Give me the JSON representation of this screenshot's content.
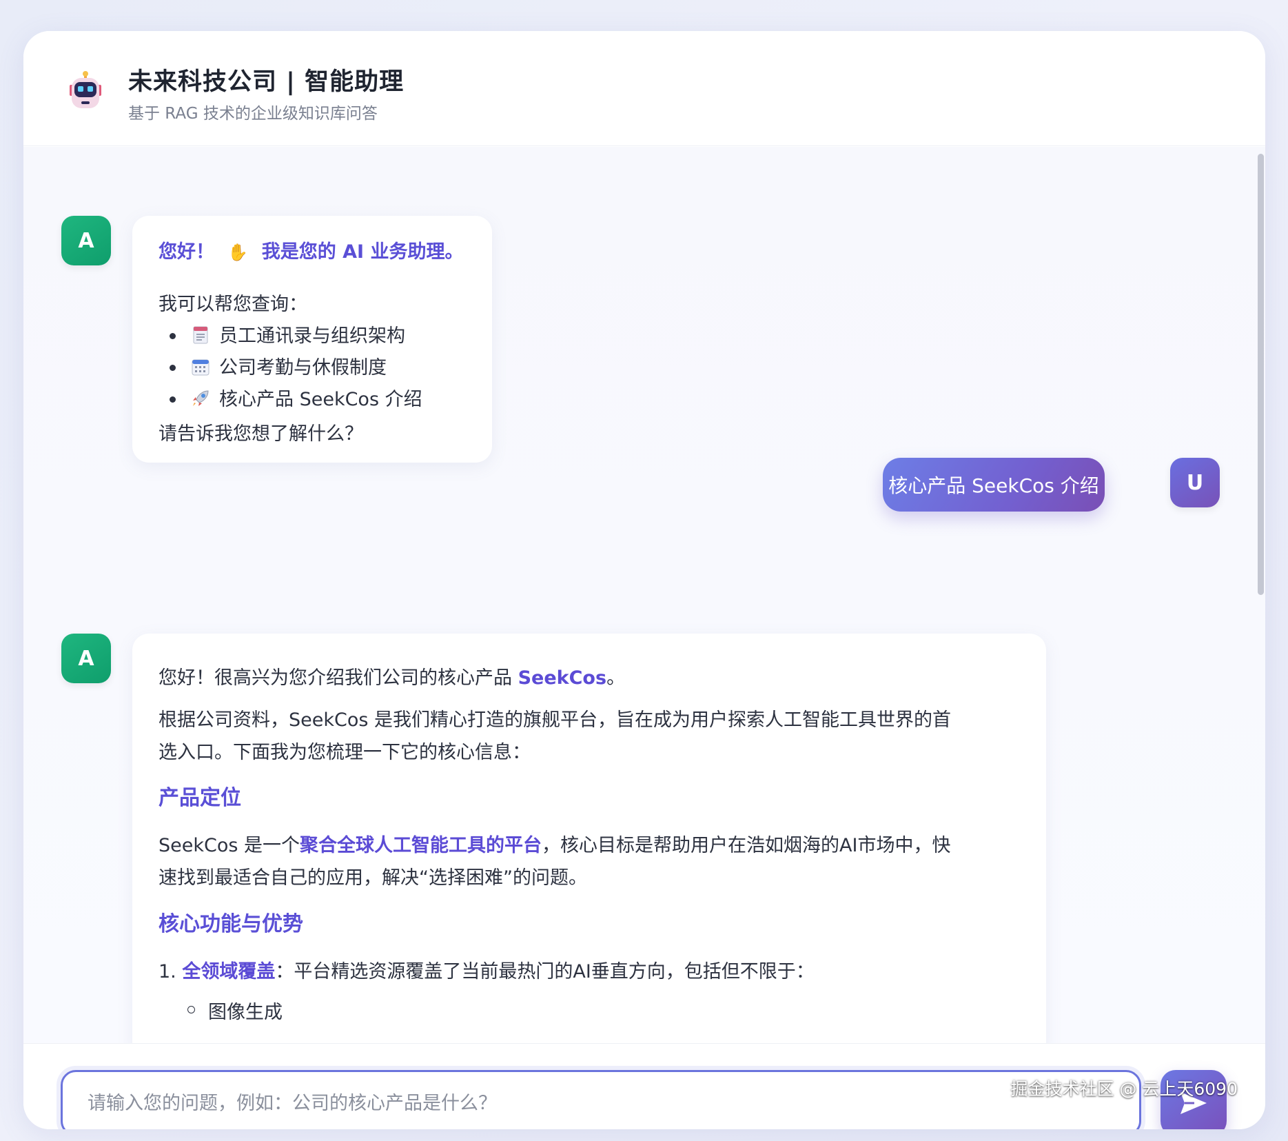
{
  "header": {
    "title": "未来科技公司 | 智能助理",
    "subtitle": "基于 RAG 技术的企业级知识库问答"
  },
  "messages": [
    {
      "role": "ai",
      "avatar": "A",
      "greeting_a": "您好！",
      "greeting_b": "我是您的 AI 业务助理。",
      "intro": "我可以帮您查询：",
      "items": [
        {
          "icon": "document-icon",
          "label": "员工通讯录与组织架构"
        },
        {
          "icon": "calendar-icon",
          "label": "公司考勤与休假制度"
        },
        {
          "icon": "rocket-icon",
          "label": "核心产品 SeekCos 介绍"
        }
      ],
      "closing": "请告诉我您想了解什么？"
    },
    {
      "role": "user",
      "avatar": "U",
      "text": "核心产品 SeekCos 介绍"
    },
    {
      "role": "ai",
      "avatar": "A",
      "p1_a": "您好！很高兴为您介绍我们公司的核心产品 ",
      "p1_b": "SeekCos",
      "p1_c": "。",
      "p2_l1": "根据公司资料，SeekCos 是我们精心打造的旗舰平台，旨在成为用户探索人工智能工具世界的首",
      "p2_l2": "选入口。下面我为您梳理一下它的核心信息：",
      "h1": "产品定位",
      "p3_a": "SeekCos 是一个",
      "p3_b": "聚合全球人工智能工具的平台",
      "p3_c": "，核心目标是帮助用户在浩如烟海的AI市场中，快",
      "p3_l2": "速找到最适合自己的应用，解决“选择困难”的问题。",
      "h2": "核心功能与优势",
      "li1_num": "1.",
      "li1_b": "全领域覆盖",
      "li1_c": "：平台精选资源覆盖了当前最热门的AI垂直方向，包括但不限于：",
      "sub1": "图像生成"
    }
  ],
  "input": {
    "placeholder": "请输入您的问题，例如：公司的核心产品是什么？"
  },
  "watermark": "掘金技术社区 @ 云上天6090",
  "colors": {
    "accent": "#5a4fd6",
    "ai_avatar": "#14a874",
    "user_bubble": "#7360d0"
  }
}
